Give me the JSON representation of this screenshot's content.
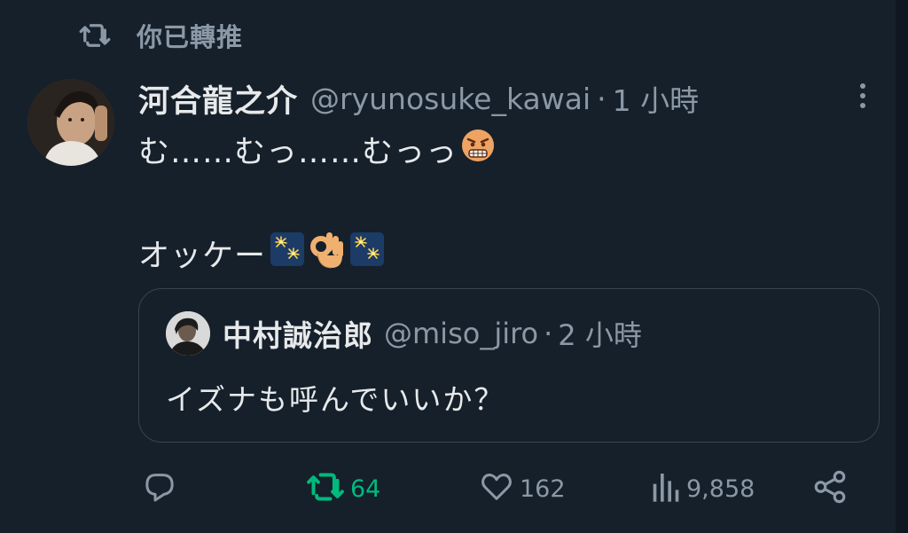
{
  "retweet_context": {
    "icon": "retweet-icon",
    "text": "你已轉推"
  },
  "tweet": {
    "author": {
      "display_name": "河合龍之介",
      "handle": "@ryunosuke_kawai",
      "avatar": "avatar-photo"
    },
    "separator": "·",
    "time": "1 小時",
    "text_line1": "む……むっ……むっっ",
    "text_line1_emoji": "angry-face-emoji",
    "text_line2": "オッケー",
    "text_line2_emojis": [
      "fireworks-emoji",
      "ok-hand-emoji",
      "fireworks-emoji"
    ]
  },
  "quoted_tweet": {
    "display_name": "中村誠治郎",
    "handle": "@miso_jiro",
    "separator": "·",
    "time": "2 小時",
    "text": "イズナも呼んでいいか？"
  },
  "actions": {
    "reply": {
      "icon": "reply-icon",
      "count": ""
    },
    "retweet": {
      "icon": "retweet-icon",
      "count": "64",
      "active": true
    },
    "like": {
      "icon": "heart-icon",
      "count": "162"
    },
    "views": {
      "icon": "views-icon",
      "count": "9,858"
    },
    "share": {
      "icon": "share-icon"
    }
  },
  "colors": {
    "background": "#15202b",
    "primary_text": "#e7e9ea",
    "secondary_text": "#8b98a5",
    "retweet_active": "#00ba7c",
    "border": "#38444d"
  }
}
